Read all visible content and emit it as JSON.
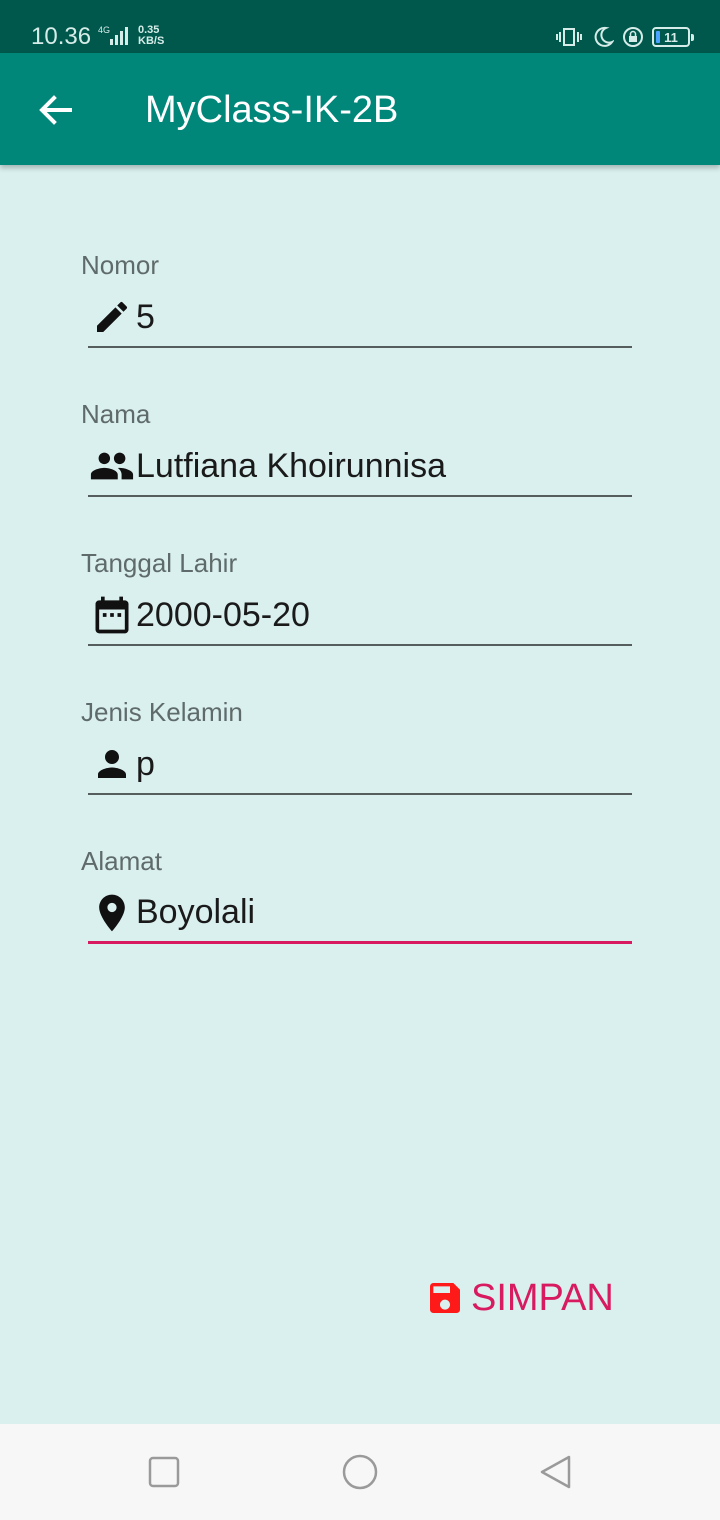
{
  "status": {
    "time": "10.36",
    "network": "4G",
    "speed_value": "0.35",
    "speed_unit": "KB/S",
    "battery": "11"
  },
  "app_bar": {
    "title": "MyClass-IK-2B"
  },
  "form": {
    "fields": [
      {
        "label": "Nomor",
        "value": "5",
        "icon": "pencil-icon"
      },
      {
        "label": "Nama",
        "value": "Lutfiana Khoirunnisa",
        "icon": "people-icon"
      },
      {
        "label": "Tanggal Lahir",
        "value": "2000-05-20",
        "icon": "calendar-icon"
      },
      {
        "label": "Jenis Kelamin",
        "value": "p",
        "icon": "person-icon"
      },
      {
        "label": "Alamat",
        "value": "Boyolali",
        "icon": "location-pin-icon"
      }
    ],
    "submit_label": "SIMPAN",
    "submit_icon": "floppy-disk-icon"
  },
  "colors": {
    "status_bar": "#00584d",
    "app_bar": "#00877a",
    "background": "#daf0ef",
    "accent": "#d81b60",
    "save_icon": "#ff1a1a"
  }
}
